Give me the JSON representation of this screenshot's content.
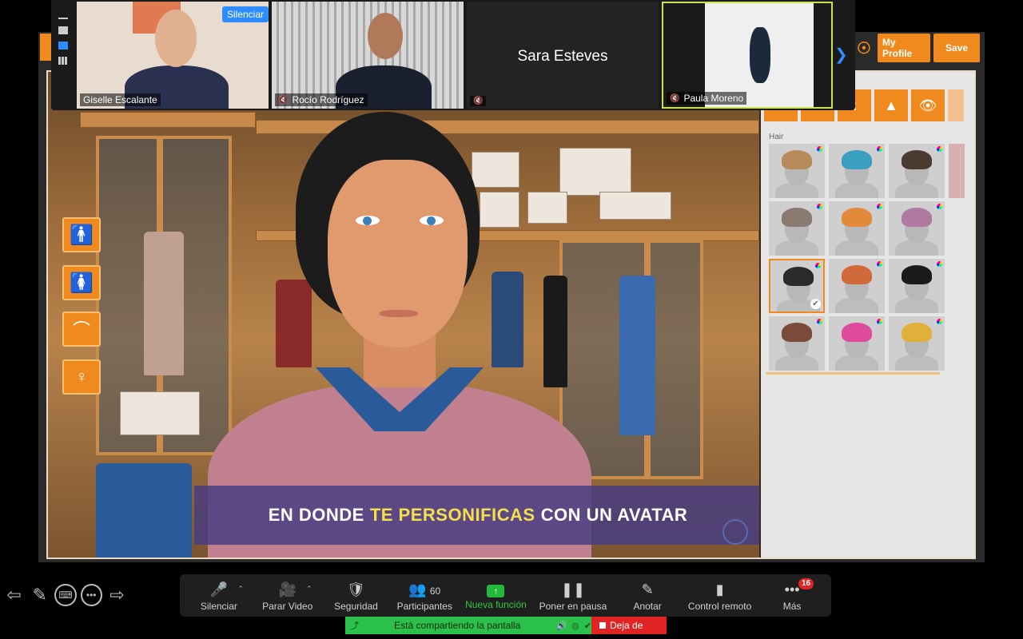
{
  "participants": [
    {
      "name": "Giselle Escalante",
      "muted": false
    },
    {
      "name": "Rocío Rodríguez",
      "muted": true
    },
    {
      "name": "Sara Esteves",
      "muted": true,
      "video_off": true
    },
    {
      "name": "Paula Moreno",
      "muted": true
    }
  ],
  "tile_actions": {
    "mute_label": "Silenciar",
    "more_label": "···"
  },
  "app": {
    "header_buttons": {
      "profile": "My Profile",
      "save": "Save"
    },
    "hair_label": "Hair",
    "caption": {
      "part1": "EN DONDE",
      "highlight": "TE PERSONIFICAS",
      "part2": "CON UN AVATAR"
    },
    "hair_colors": [
      "#b78a5a",
      "#3aa0c0",
      "#4a3a30",
      "#8a7a70",
      "#e08a3a",
      "#b07aa0",
      "#2a2a2a",
      "#d06a3a",
      "#1a1a1a",
      "#7a4a3a",
      "#e04a9a",
      "#e0b03a"
    ],
    "selected_hair_index": 6
  },
  "toolbar": {
    "mute": "Silenciar",
    "video": "Parar Video",
    "security": "Seguridad",
    "participants": "Participantes",
    "participants_count": "60",
    "new_feature": "Nueva función",
    "pause": "Poner en pausa",
    "annotate": "Anotar",
    "remote": "Control remoto",
    "more": "Más",
    "more_badge": "16"
  },
  "share_bar": {
    "status": "Está compartiendo la pantalla",
    "stop": "Deja de"
  },
  "colors": {
    "accent_orange": "#f08a1e",
    "zoom_blue": "#2d8cff",
    "share_green": "#2bc04a",
    "stop_red": "#e02424"
  }
}
